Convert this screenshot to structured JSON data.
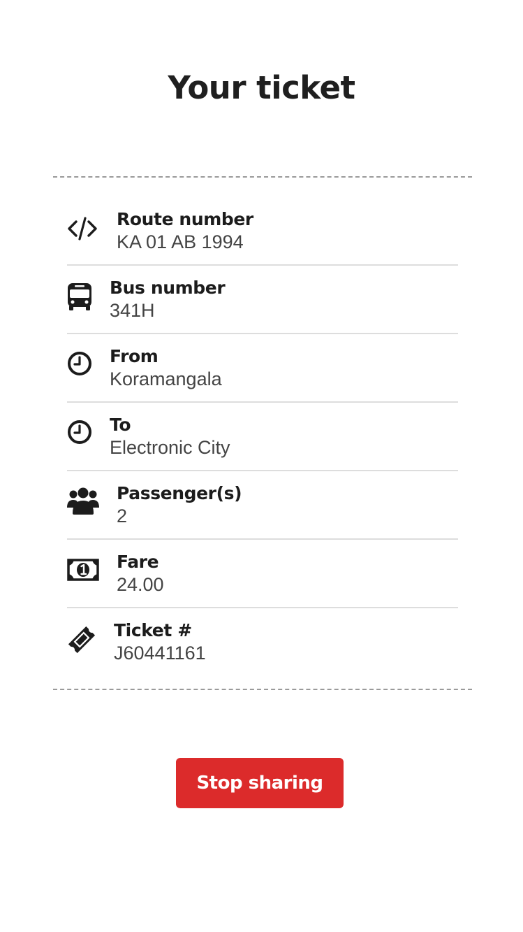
{
  "page": {
    "title": "Your ticket"
  },
  "ticket": {
    "route": {
      "label": "Route number",
      "value": "KA 01 AB 1994",
      "icon": "code-icon"
    },
    "bus": {
      "label": "Bus number",
      "value": "341H",
      "icon": "bus-icon"
    },
    "from": {
      "label": "From",
      "value": "Koramangala",
      "icon": "clock-icon"
    },
    "to": {
      "label": "To",
      "value": "Electronic City",
      "icon": "clock-icon"
    },
    "passengers": {
      "label": "Passenger(s)",
      "value": "2",
      "icon": "users-icon"
    },
    "fare": {
      "label": "Fare",
      "value": "24.00",
      "icon": "money-icon"
    },
    "ticket_no": {
      "label": "Ticket #",
      "value": "J60441161",
      "icon": "ticket-icon"
    }
  },
  "actions": {
    "stop_sharing_label": "Stop sharing"
  },
  "colors": {
    "accent": "#dc2b2b",
    "text": "#1c1c1c",
    "muted": "#444444",
    "divider": "#dddddd"
  }
}
